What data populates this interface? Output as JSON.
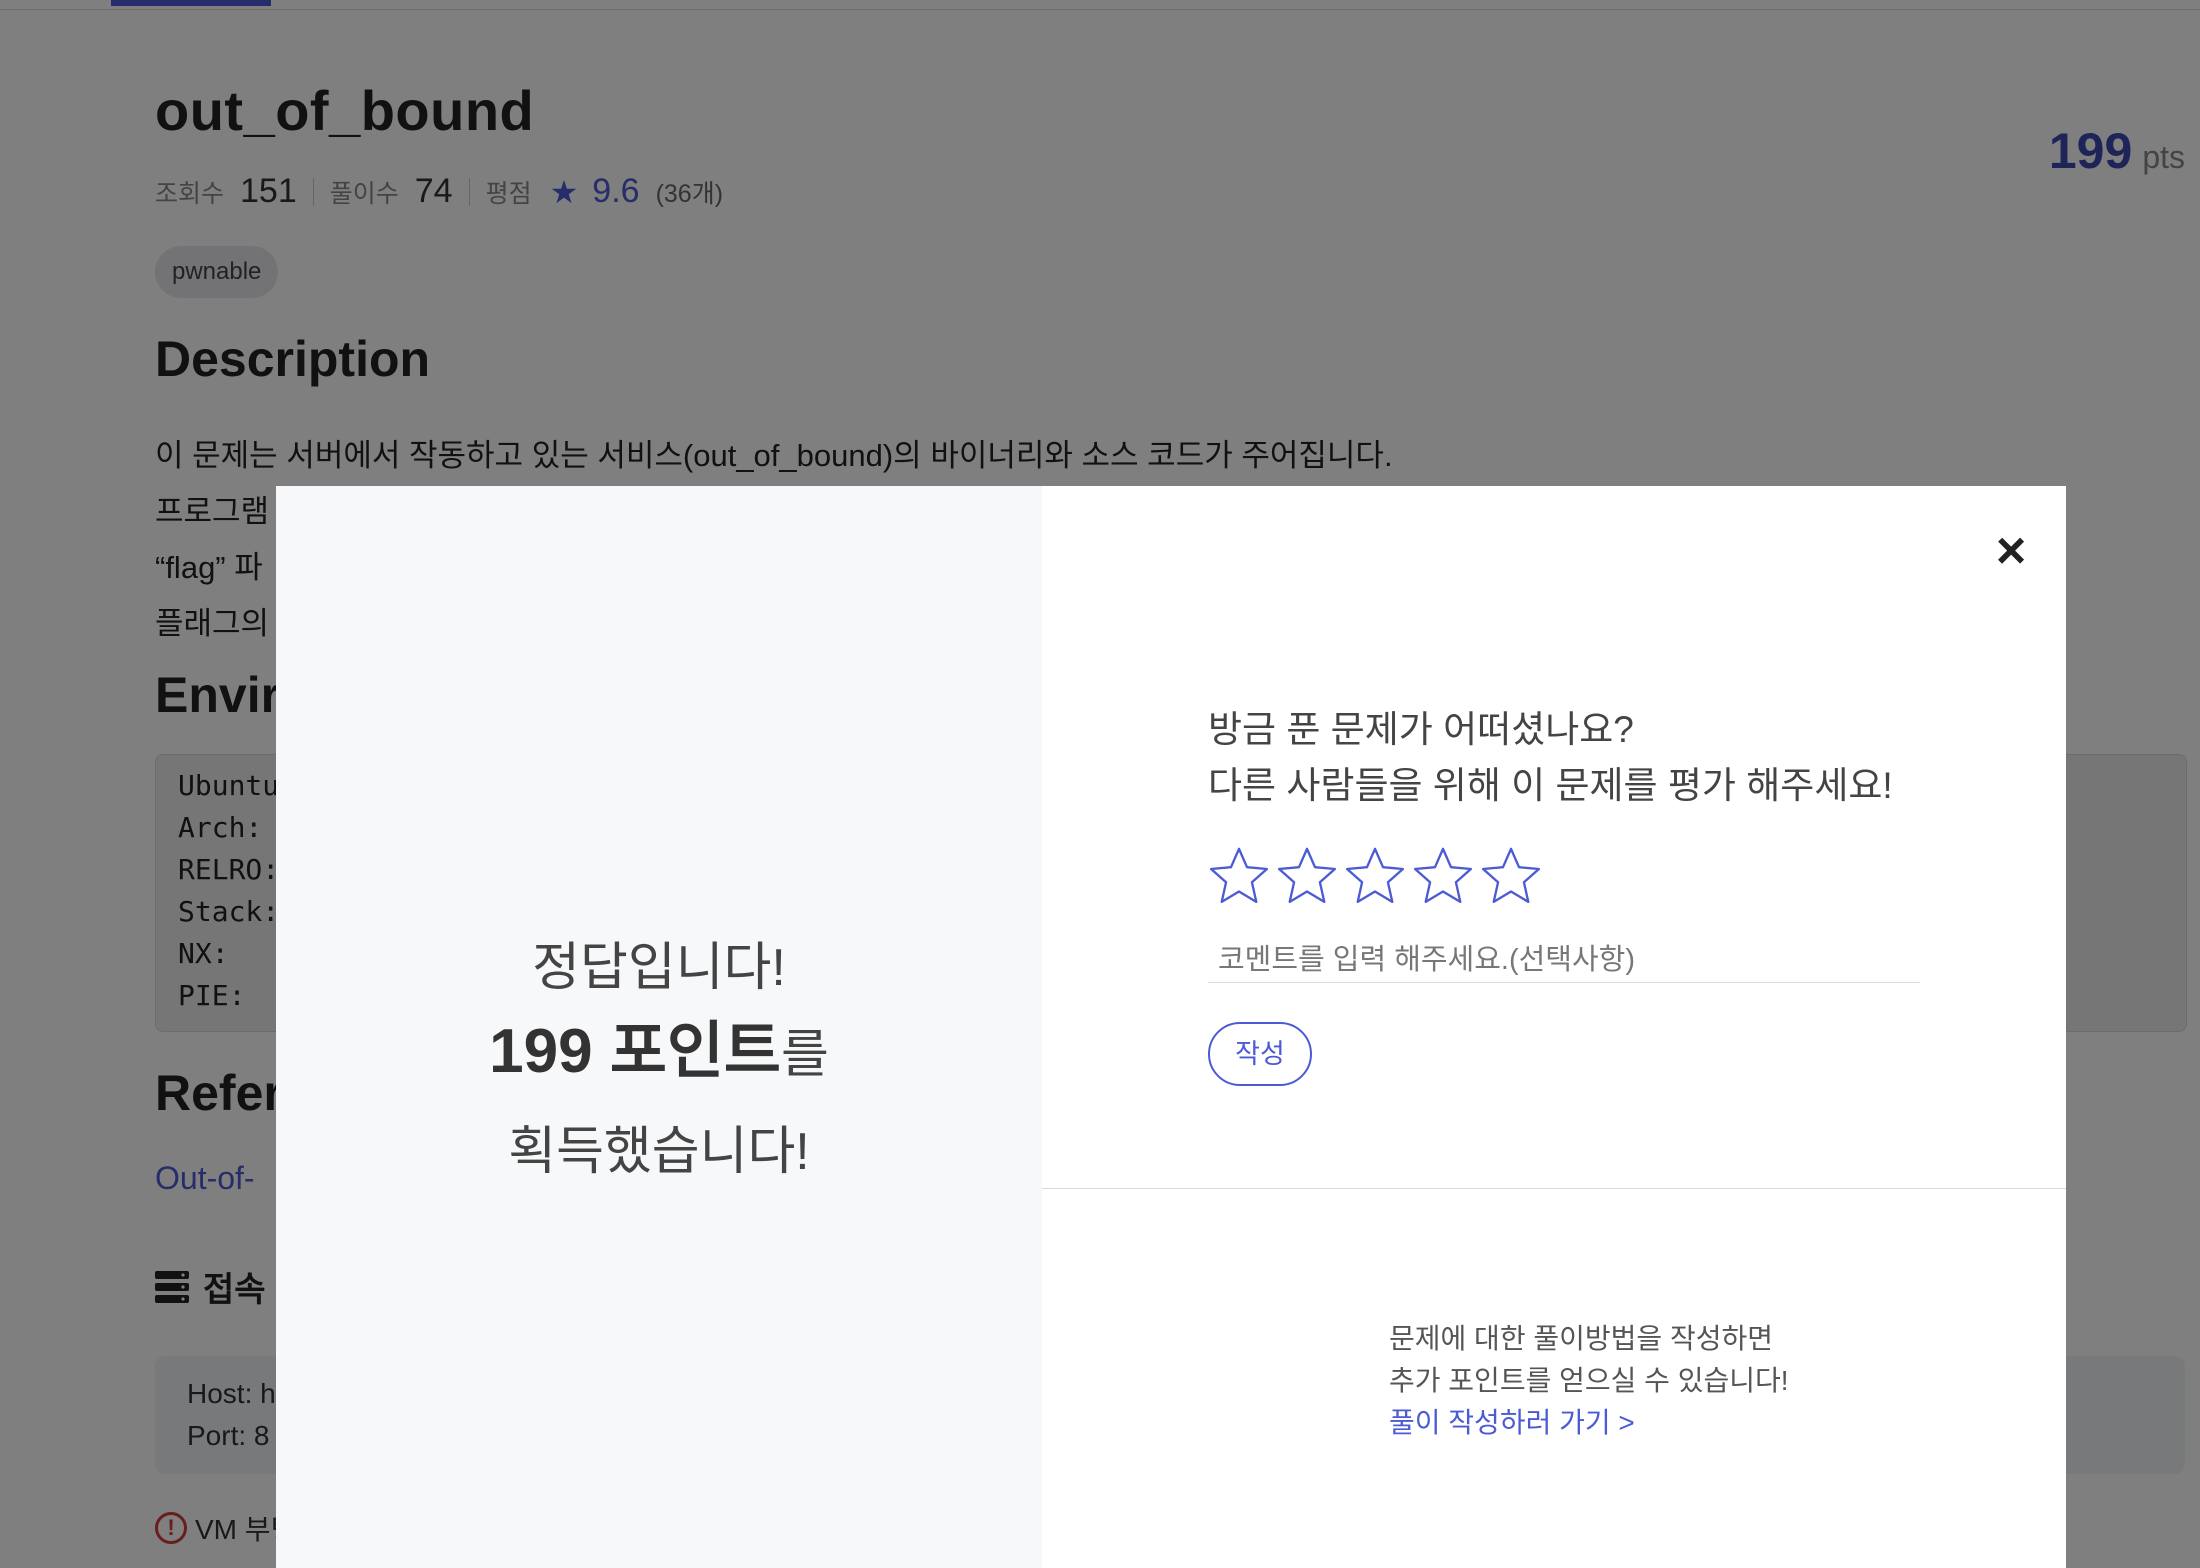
{
  "problem": {
    "title": "out_of_bound",
    "points": "199",
    "points_unit": "pts",
    "views_label": "조회수",
    "views": "151",
    "solves_label": "풀이수",
    "solves": "74",
    "rating_label": "평점",
    "rating": "9.6",
    "rating_count": "(36개)",
    "tag": "pwnable"
  },
  "description": {
    "heading": "Description",
    "lines": [
      "이 문제는 서버에서 작동하고 있는 서비스(out_of_bound)의 바이너리와 소스 코드가 주어집니다.",
      "프로그램",
      "“flag” 파",
      "플래그의"
    ]
  },
  "environment": {
    "heading": "Envir",
    "lines": [
      "Ubuntu",
      "Arch:",
      "RELRO:",
      "Stack:",
      "NX:",
      "PIE:"
    ]
  },
  "reference": {
    "heading": "Refer",
    "link": "Out-of-"
  },
  "server": {
    "label": "접속",
    "host": "Host: h",
    "port": "Port: 8"
  },
  "warning": {
    "text": "VM 부팅"
  },
  "modal": {
    "success_line1": "정답입니다!",
    "success_points": "199 포인트",
    "success_particle": "를",
    "success_line3": "획득했습니다!",
    "ask_line1": "방금 푼 문제가 어떠셨나요?",
    "ask_line2": "다른 사람들을 위해 이 문제를 평가 해주세요!",
    "stars_filled": 0,
    "stars_total": 5,
    "comment_placeholder": "코멘트를 입력 해주세요.(선택사항)",
    "comment_value": "",
    "submit_label": "작성",
    "writeup_line1": "문제에 대한 풀이방법을 작성하면",
    "writeup_line2": "추가 포인트를 얻으실 수 있습니다!",
    "writeup_link": "풀이 작성하러 가기 >"
  },
  "colors": {
    "accent": "#4c5bd4",
    "points": "#3e49b0",
    "overlay": "rgba(0,0,0,0.5)",
    "warning": "#d23b3b"
  }
}
